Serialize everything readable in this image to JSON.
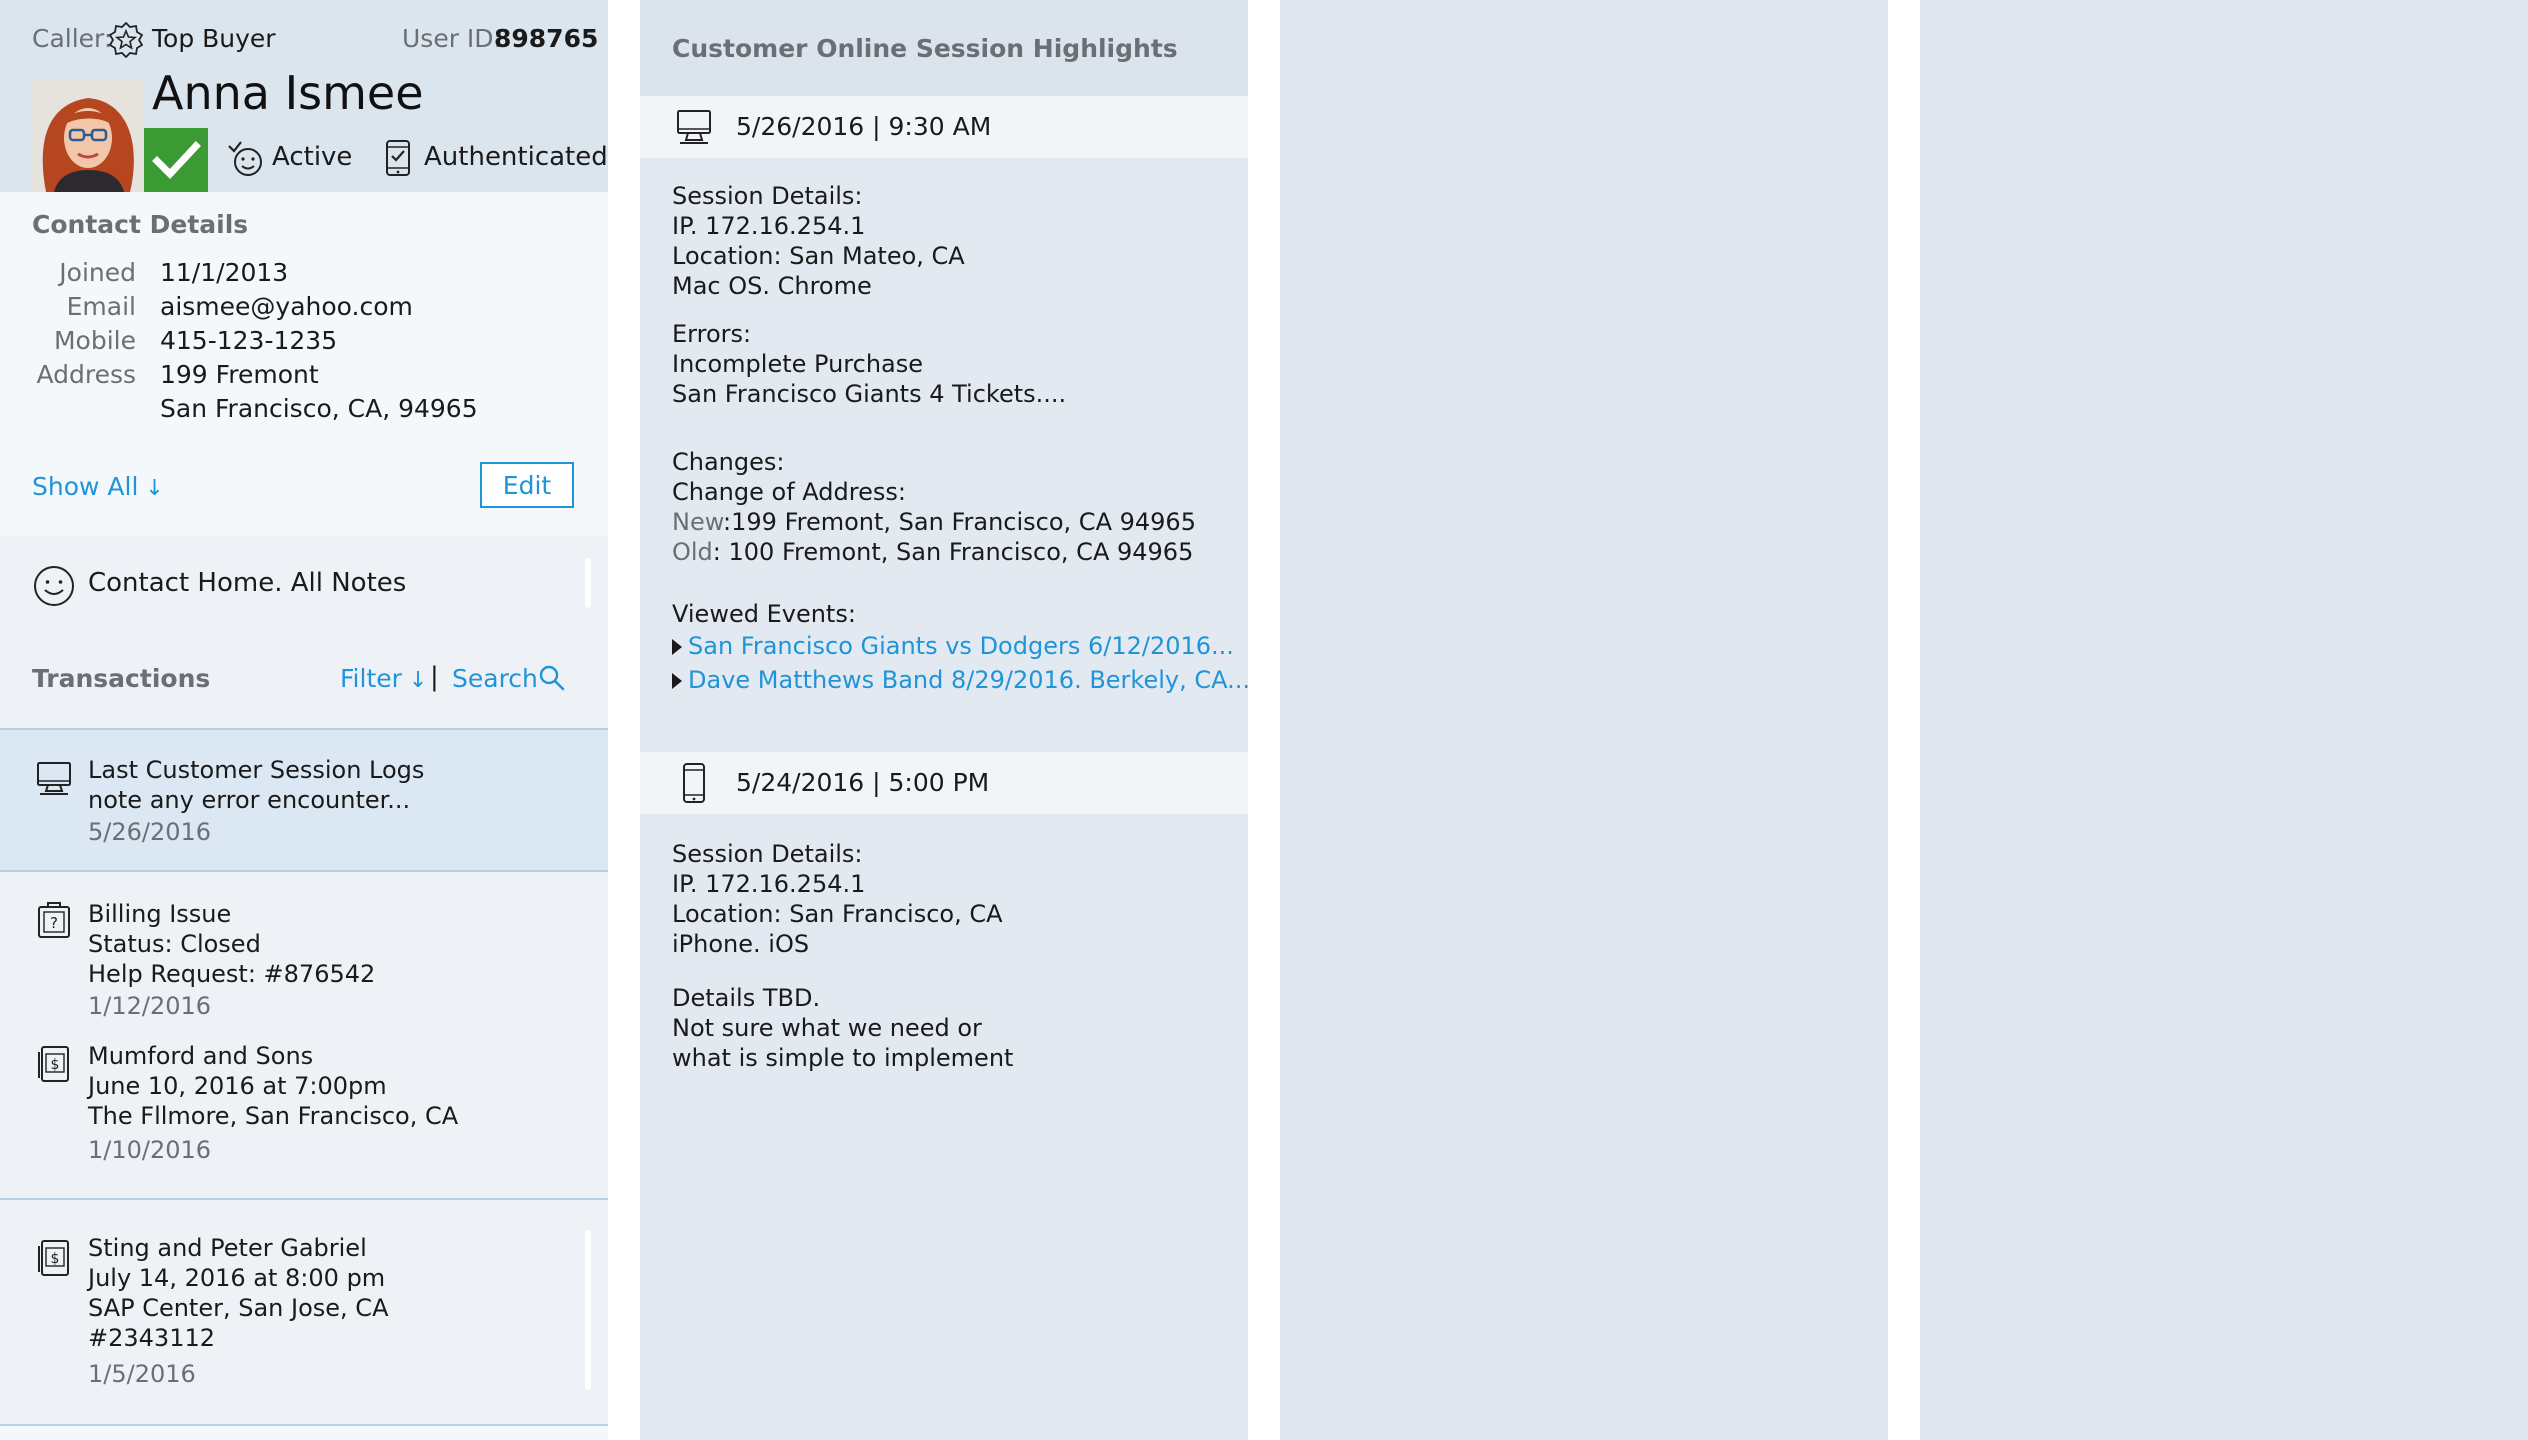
{
  "caller": {
    "label": "Caller:",
    "badge_icon": "award-badge-icon",
    "tier": "Top Buyer",
    "user_id_label": "User ID:",
    "user_id": "898765",
    "name": "Anna Ismee",
    "active_label": "Active",
    "authenticated_label": "Authenticated"
  },
  "contact": {
    "title": "Contact Details",
    "joined_key": "Joined",
    "joined": "11/1/2013",
    "email_key": "Email",
    "email": "aismee@yahoo.com",
    "mobile_key": "Mobile",
    "mobile": "415-123-1235",
    "address_key": "Address",
    "address_line1": "199 Fremont",
    "address_line2": "San Francisco, CA, 94965",
    "show_all": "Show All",
    "edit": "Edit"
  },
  "notes": {
    "label": "Contact Home. All Notes"
  },
  "transactions": {
    "title": "Transactions",
    "filter": "Filter",
    "divider": "|",
    "search": "Search",
    "items": [
      {
        "icon": "monitor-icon",
        "lines": [
          "Last Customer Session Logs"
        ],
        "note": "note any error encounter...",
        "date": "5/26/2016"
      },
      {
        "icon": "help-ticket-icon",
        "lines": [
          "Billing Issue",
          "Status: Closed",
          "Help Request: #876542"
        ],
        "date": "1/12/2016"
      },
      {
        "icon": "ticket-dollar-icon",
        "lines": [
          "Mumford and Sons",
          "June 10, 2016 at 7:00pm",
          "The Fllmore, San Francisco, CA"
        ],
        "date": "1/10/2016"
      },
      {
        "icon": "ticket-dollar-icon",
        "lines": [
          "Sting and Peter Gabriel",
          "July 14, 2016 at 8:00 pm",
          "SAP Center, San Jose, CA",
          "#2343112"
        ],
        "date": "1/5/2016"
      }
    ]
  },
  "session_panel": {
    "title": "Customer Online Session Highlights",
    "sessions": [
      {
        "icon": "monitor-icon",
        "datetime": "5/26/2016 | 9:30 AM",
        "details_title": "Session Details:",
        "ip": "IP. 172.16.254.1",
        "location": "Location: San Mateo, CA",
        "platform": "Mac OS. Chrome",
        "errors_title": "Errors:",
        "error": "Incomplete Purchase",
        "error_link": "San Francisco Giants 4 Tickets....",
        "changes_title": "Changes:",
        "change_type": "Change of Address:",
        "new_label": "New",
        "new_value": ":199 Fremont, San Francisco, CA 94965",
        "old_label": "Old",
        "old_value": ":  100 Fremont, San Francisco, CA 94965",
        "viewed_title": "Viewed Events:",
        "viewed": [
          "San Francisco Giants vs Dodgers 6/12/2016...",
          "Dave Matthews Band 8/29/2016. Berkely, CA..."
        ]
      },
      {
        "icon": "mobile-phone-icon",
        "datetime": "5/24/2016 | 5:00 PM",
        "details_title": "Session Details:",
        "ip": "IP. 172.16.254.1",
        "location": "Location: San Francisco, CA",
        "platform": "iPhone. iOS",
        "tbd": "Details TBD.",
        "note1": "Not sure what we need or",
        "note2": "what is simple to implement"
      }
    ]
  },
  "colors": {
    "accent": "#1f94d8",
    "warning": "#f08a12",
    "success": "#3c9a35",
    "header_bg": "#dbe5ee",
    "panel_bg": "#e2e9f1"
  }
}
